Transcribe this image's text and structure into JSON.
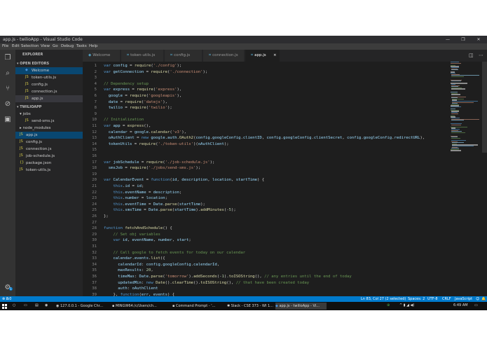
{
  "window": {
    "title": "app.js - twilioApp - Visual Studio Code"
  },
  "menu": [
    "File",
    "Edit",
    "Selection",
    "View",
    "Go",
    "Debug",
    "Tasks",
    "Help"
  ],
  "sidebar": {
    "explorer": "EXPLORER",
    "open_editors_header": "OPEN EDITORS",
    "open_editors": [
      "Welcome",
      "token-utils.js",
      "config.js",
      "connection.js",
      "app.js"
    ],
    "project_header": "TWILIOAPP",
    "tree": [
      "jobs",
      "send-sms.js",
      "node_modules",
      "app.js",
      "config.js",
      "connection.js",
      "job-schedule.js",
      "package.json",
      "token-utils.js"
    ]
  },
  "tabs": [
    "Welcome",
    "token-utils.js",
    "config.js",
    "connection.js",
    "app.js"
  ],
  "tab_close": "×",
  "code": [
    {
      "n": "1",
      "t": "var config = require('./config');"
    },
    {
      "n": "2",
      "t": "var getConnection = require('./connection');"
    },
    {
      "n": "3",
      "t": ""
    },
    {
      "n": "4",
      "t": "// Dependency setup"
    },
    {
      "n": "5",
      "t": "var express = require('express'),"
    },
    {
      "n": "6",
      "t": "  google = require('googleapis'),"
    },
    {
      "n": "7",
      "t": "  date = require('datejs'),"
    },
    {
      "n": "8",
      "t": "  twilio = require('twilio');"
    },
    {
      "n": "9",
      "t": ""
    },
    {
      "n": "10",
      "t": "// Initialization"
    },
    {
      "n": "11",
      "t": "var app = express(),"
    },
    {
      "n": "12",
      "t": "  calendar = google.calendar('v3'),"
    },
    {
      "n": "13",
      "t": "  oAuthClient = new google.auth.OAuth2(config.googleConfig.clientID, config.googleConfig.clientSecret, config.googleConfig.redirectURL),"
    },
    {
      "n": "14",
      "t": "  tokenUtils = require('./token-utils')(oAuthClient);"
    },
    {
      "n": "15",
      "t": ""
    },
    {
      "n": "16",
      "t": ""
    },
    {
      "n": "17",
      "t": "var jobSchedule = require('./job-schedule.js');"
    },
    {
      "n": "18",
      "t": "  smsJob = require('./jobs/send-sms.js');"
    },
    {
      "n": "19",
      "t": ""
    },
    {
      "n": "20",
      "t": "var CalendarEvent = function(id, description, location, startTime) {"
    },
    {
      "n": "21",
      "t": "    this.id = id;"
    },
    {
      "n": "22",
      "t": "    this.eventName = description;"
    },
    {
      "n": "23",
      "t": "    this.number = location;"
    },
    {
      "n": "24",
      "t": "    this.eventTime = Date.parse(startTime);"
    },
    {
      "n": "25",
      "t": "    this.smsTime = Date.parse(startTime).addMinutes(-5);"
    },
    {
      "n": "26",
      "t": "};"
    },
    {
      "n": "27",
      "t": ""
    },
    {
      "n": "28",
      "t": "function fetchAndSchedule() {"
    },
    {
      "n": "29",
      "t": "    // Set obj variables"
    },
    {
      "n": "30",
      "t": "    var id, eventName, number, start;"
    },
    {
      "n": "31",
      "t": ""
    },
    {
      "n": "32",
      "t": "    // Call google to fetch events for today on our calendar"
    },
    {
      "n": "33",
      "t": "    calendar.events.list({"
    },
    {
      "n": "34",
      "t": "      calendarId: config.googleConfig.calendarId,"
    },
    {
      "n": "35",
      "t": "      maxResults: 20,"
    },
    {
      "n": "36",
      "t": "      timeMax: Date.parse('tomorrow').addSeconds(-1).toISOString(), // any entries until the end of today"
    },
    {
      "n": "37",
      "t": "      updatedMin: new Date().clearTime().toISOString(), // that have been created today"
    },
    {
      "n": "38",
      "t": "      auth: oAuthClient"
    },
    {
      "n": "39",
      "t": "    }, function(err, events) {"
    }
  ],
  "status": {
    "errors": "0",
    "warnings": "0",
    "position": "Ln 83, Col 27 (2 selected)",
    "spaces": "Spaces: 2",
    "encoding": "UTF-8",
    "eol": "CRLF",
    "language": "JavaScript"
  },
  "taskbar": {
    "items": [
      "127.0.0.1 - Google Chr...",
      "MINGW64:/c/Users/ch...",
      "Command Prompt - '...",
      "Slack - CSE 373 - WI 1...",
      "app.js - twilioApp - Vi..."
    ],
    "time": "6:49 AM"
  },
  "colors": {
    "accent": "#007acc",
    "editor_bg": "#1e1e1e",
    "sidebar_bg": "#252526"
  }
}
